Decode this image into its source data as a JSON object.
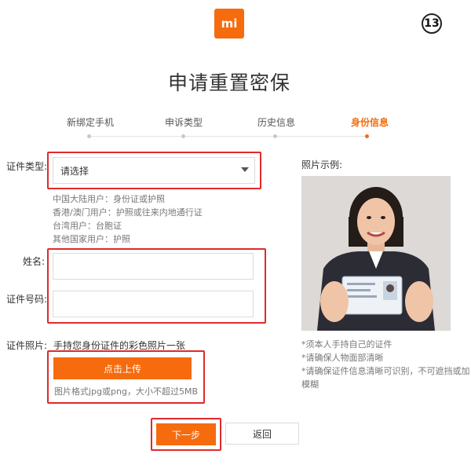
{
  "logo": {
    "text": "mi"
  },
  "step_number": "13",
  "page_title": "申请重置密保",
  "steps": [
    {
      "label": "新绑定手机",
      "active": false
    },
    {
      "label": "申诉类型",
      "active": false
    },
    {
      "label": "历史信息",
      "active": false
    },
    {
      "label": "身份信息",
      "active": true
    }
  ],
  "form": {
    "id_type": {
      "label": "证件类型:",
      "selected": "请选择",
      "hints": [
        "中国大陆用户：身份证或护照",
        "香港/澳门用户：护照或往来内地通行证",
        "台湾用户：台胞证",
        "其他国家用户：护照"
      ]
    },
    "name": {
      "label": "姓名:",
      "value": ""
    },
    "id_number": {
      "label": "证件号码:",
      "value": ""
    },
    "photo": {
      "label": "证件照片:",
      "instruction": "手持您身份证件的彩色照片一张",
      "upload_label": "点击上传",
      "format_note": "图片格式jpg或png，大小不超过5MB"
    }
  },
  "buttons": {
    "next": "下一步",
    "back": "返回"
  },
  "example": {
    "label": "照片示例:",
    "notes": [
      "*须本人手持自己的证件",
      "*请确保人物面部清晰",
      "*请确保证件信息清晰可识别，不可遮挡或加",
      "模糊"
    ]
  },
  "colors": {
    "accent": "#f56b0d",
    "annotation": "#e02a2a"
  }
}
